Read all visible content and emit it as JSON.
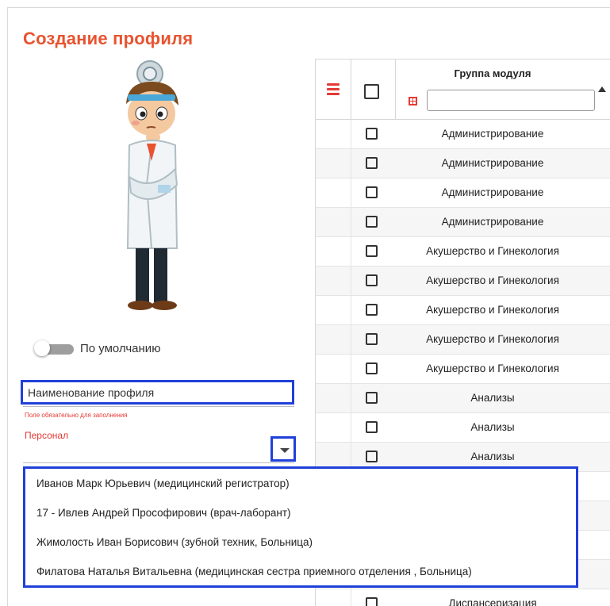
{
  "page": {
    "title": "Создание профиля"
  },
  "form": {
    "default_toggle_label": "По умолчанию",
    "default_toggle_on": false,
    "profile_name_placeholder": "Наименование профиля",
    "required_hint": "Поле обязательно для заполнения",
    "staff_label": "Персонал"
  },
  "staff_options": [
    "Иванов Марк Юрьевич (медицинский регистратор)",
    "17 - Ивлев Андрей Прософирович (врач-лаборант)",
    "Жимолость Иван Борисович (зубной техник, Больница)",
    "Филатова Наталья Витальевна (медицинская сестра приемного отделения , Больница)"
  ],
  "grid": {
    "column_title": "Группа модуля",
    "menu_icon": "hamburger-menu-icon",
    "filter_icon": "filter-icon",
    "rows": [
      "Администрирование",
      "Администрирование",
      "Администрирование",
      "Администрирование",
      "Акушерство и Гинекология",
      "Акушерство и Гинекология",
      "Акушерство и Гинекология",
      "Акушерство и Гинекология",
      "Акушерство и Гинекология",
      "Анализы",
      "Анализы",
      "Анализы",
      "",
      "",
      "",
      "",
      "Диспансеризация"
    ]
  },
  "colors": {
    "accent": "#e8532f",
    "highlight_border": "#2040d8",
    "error": "#e53935"
  }
}
